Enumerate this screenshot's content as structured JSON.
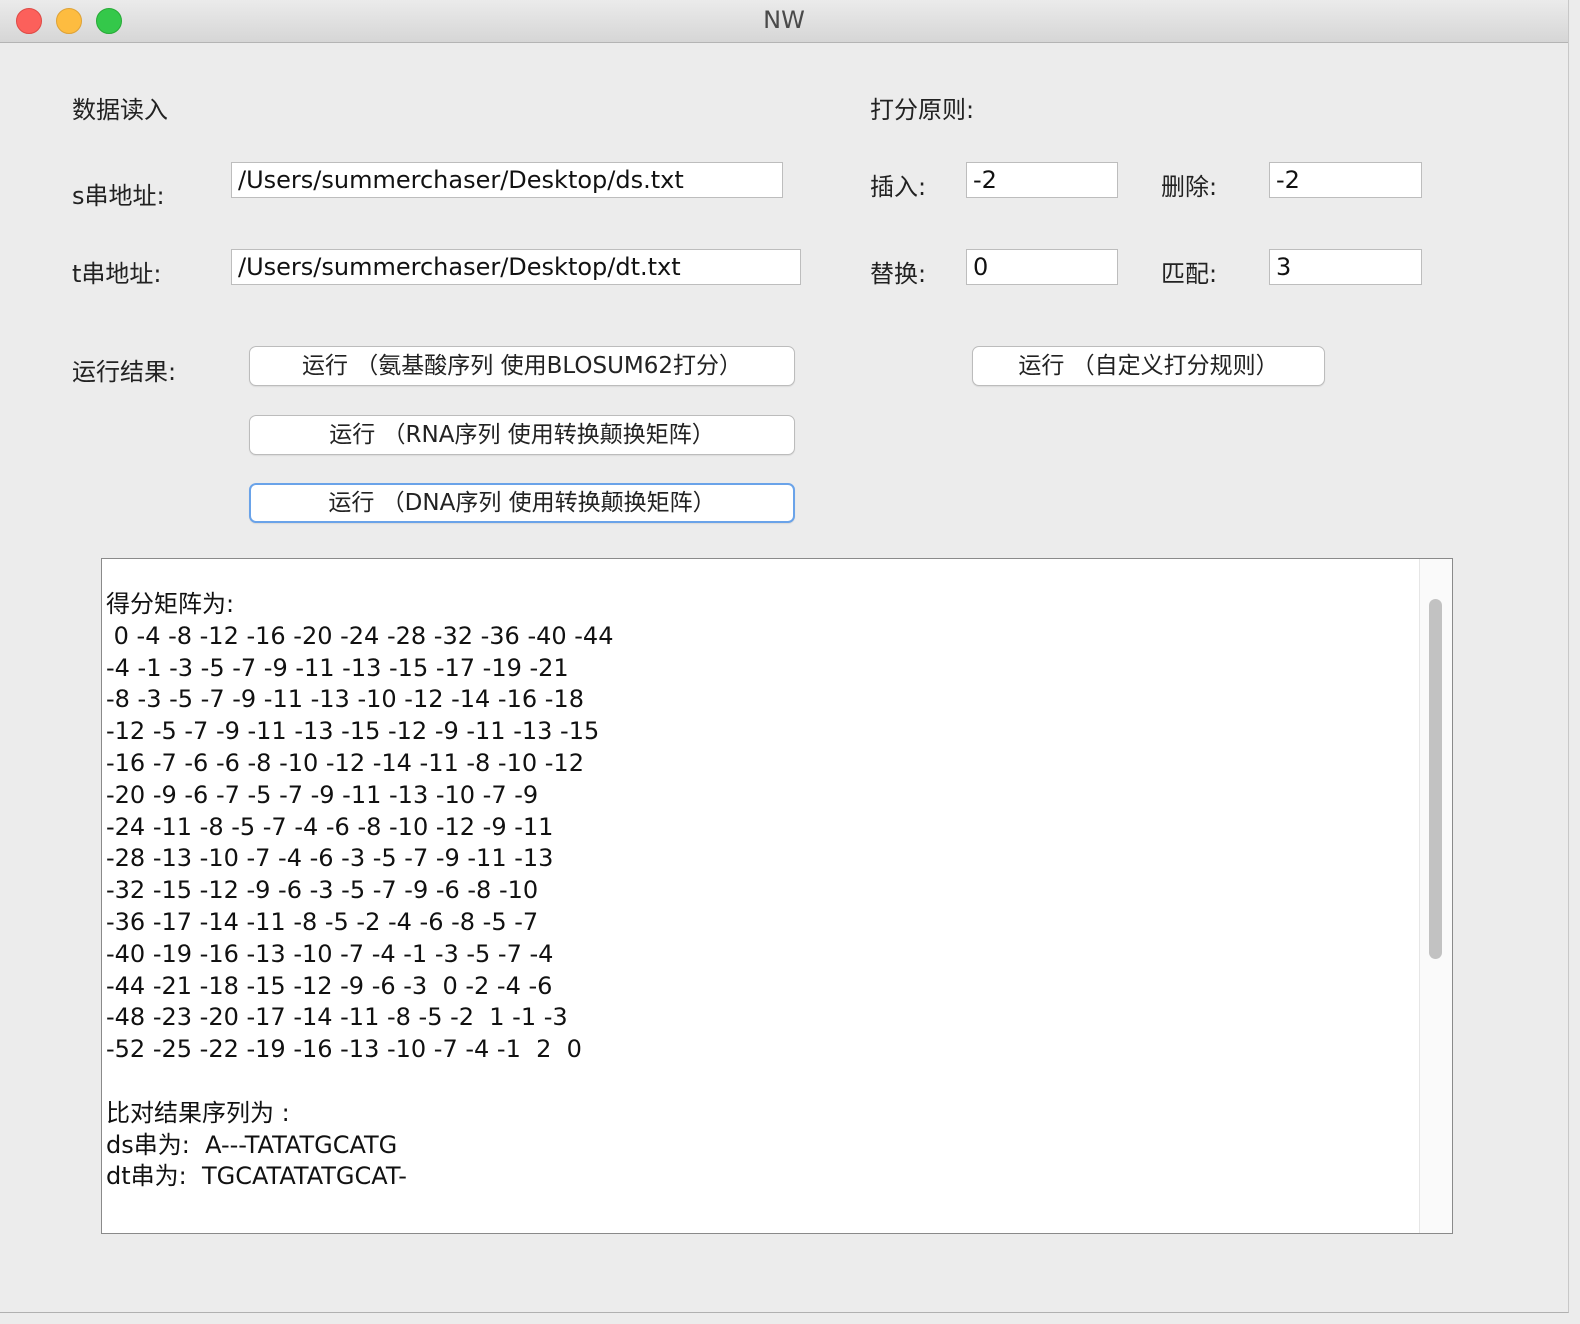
{
  "window": {
    "title": "NW"
  },
  "input_section": {
    "heading": "数据读入",
    "s_label": "s串地址:",
    "s_value": "/Users/summerchaser/Desktop/ds.txt",
    "t_label": "t串地址:",
    "t_value": "/Users/summerchaser/Desktop/dt.txt"
  },
  "scoring": {
    "heading": "打分原则:",
    "insert_label": "插入:",
    "insert_value": "-2",
    "delete_label": "删除:",
    "delete_value": "-2",
    "replace_label": "替换:",
    "replace_value": "0",
    "match_label": "匹配:",
    "match_value": "3"
  },
  "run": {
    "label": "运行结果:",
    "btn_protein": "运行 （氨基酸序列 使用BLOSUM62打分）",
    "btn_custom": "运行 （自定义打分规则）",
    "btn_rna": "运行 （RNA序列 使用转换颠换矩阵）",
    "btn_dna": "运行 （DNA序列 使用转换颠换矩阵）"
  },
  "result": {
    "text": "得分矩阵为:\n 0 -4 -8 -12 -16 -20 -24 -28 -32 -36 -40 -44\n-4 -1 -3 -5 -7 -9 -11 -13 -15 -17 -19 -21\n-8 -3 -5 -7 -9 -11 -13 -10 -12 -14 -16 -18\n-12 -5 -7 -9 -11 -13 -15 -12 -9 -11 -13 -15\n-16 -7 -6 -6 -8 -10 -12 -14 -11 -8 -10 -12\n-20 -9 -6 -7 -5 -7 -9 -11 -13 -10 -7 -9\n-24 -11 -8 -5 -7 -4 -6 -8 -10 -12 -9 -11\n-28 -13 -10 -7 -4 -6 -3 -5 -7 -9 -11 -13\n-32 -15 -12 -9 -6 -3 -5 -7 -9 -6 -8 -10\n-36 -17 -14 -11 -8 -5 -2 -4 -6 -8 -5 -7\n-40 -19 -16 -13 -10 -7 -4 -1 -3 -5 -7 -4\n-44 -21 -18 -15 -12 -9 -6 -3  0 -2 -4 -6\n-48 -23 -20 -17 -14 -11 -8 -5 -2  1 -1 -3\n-52 -25 -22 -19 -16 -13 -10 -7 -4 -1  2  0\n\n比对结果序列为 :\nds串为:  A---TATATGCATG\ndt串为:  TGCATATATGCAT-"
  }
}
